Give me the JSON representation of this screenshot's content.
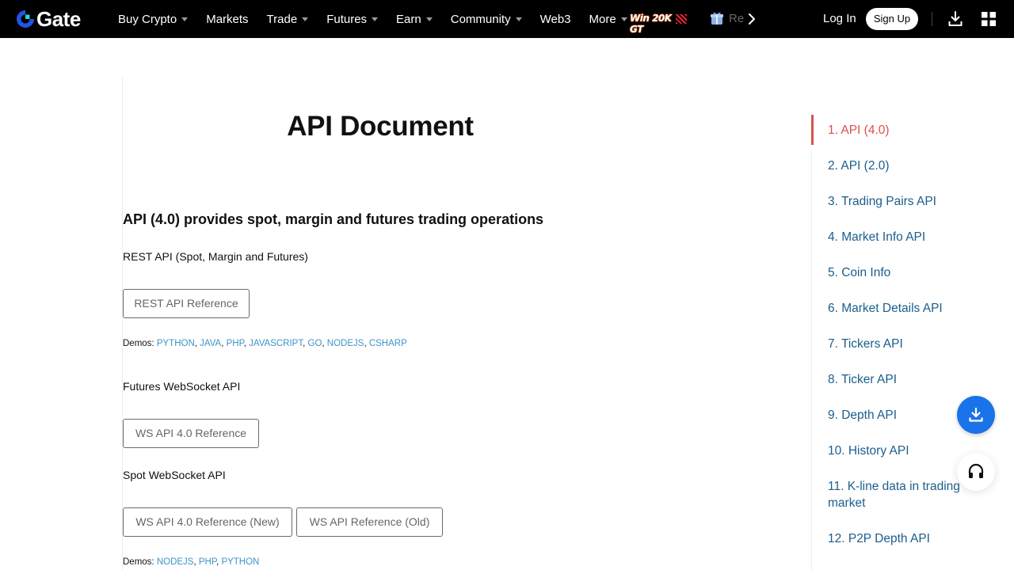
{
  "header": {
    "brand": "Gate",
    "nav": [
      {
        "label": "Buy Crypto",
        "dropdown": true
      },
      {
        "label": "Markets",
        "dropdown": false
      },
      {
        "label": "Trade",
        "dropdown": true
      },
      {
        "label": "Futures",
        "dropdown": true
      },
      {
        "label": "Earn",
        "dropdown": true
      },
      {
        "label": "Community",
        "dropdown": true
      },
      {
        "label": "Web3",
        "dropdown": false
      },
      {
        "label": "More",
        "dropdown": true
      }
    ],
    "promo_label": "Win 20K GT",
    "rewards_label": "Re",
    "login_label": "Log In",
    "signup_label": "Sign Up"
  },
  "main": {
    "title": "API Document",
    "intro": "API (4.0) provides spot, margin and futures trading operations",
    "rest": {
      "heading": "REST API (Spot, Margin and Futures)",
      "button": "REST API Reference",
      "demos_label": "Demos:",
      "demos": [
        "PYTHON",
        "JAVA",
        "PHP",
        "JAVASCRIPT",
        "GO",
        "NODEJS",
        "CSHARP"
      ]
    },
    "futures_ws": {
      "heading": "Futures WebSocket API",
      "button": "WS API 4.0 Reference"
    },
    "spot_ws": {
      "heading": "Spot WebSocket API",
      "button_new": "WS API 4.0 Reference (New)",
      "button_old": "WS API Reference (Old)",
      "demos_label": "Demos:",
      "demos": [
        "NODEJS",
        "PHP",
        "PYTHON"
      ]
    }
  },
  "toc": {
    "items": [
      "1. API (4.0)",
      "2. API (2.0)",
      "3. Trading Pairs API",
      "4. Market Info API",
      "5. Coin Info",
      "6. Market Details API",
      "7. Tickers API",
      "8. Ticker API",
      "9. Depth API",
      "10. History API",
      "11. K-line data in trading market",
      "12. P2P Depth API"
    ],
    "active_index": 0
  },
  "colors": {
    "nav_bg": "#000000",
    "brand_blue": "#2354e6",
    "link": "#3c94c8",
    "toc_link": "#1b5e8c",
    "toc_active": "#d9514e",
    "fab_blue": "#1a73e8"
  },
  "icons": {
    "logo": "gate-logo-icon",
    "download": "download-icon",
    "apps": "apps-grid-icon",
    "gift": "gift-box-icon",
    "nav_next": "chevron-right-icon",
    "support": "headset-icon"
  }
}
